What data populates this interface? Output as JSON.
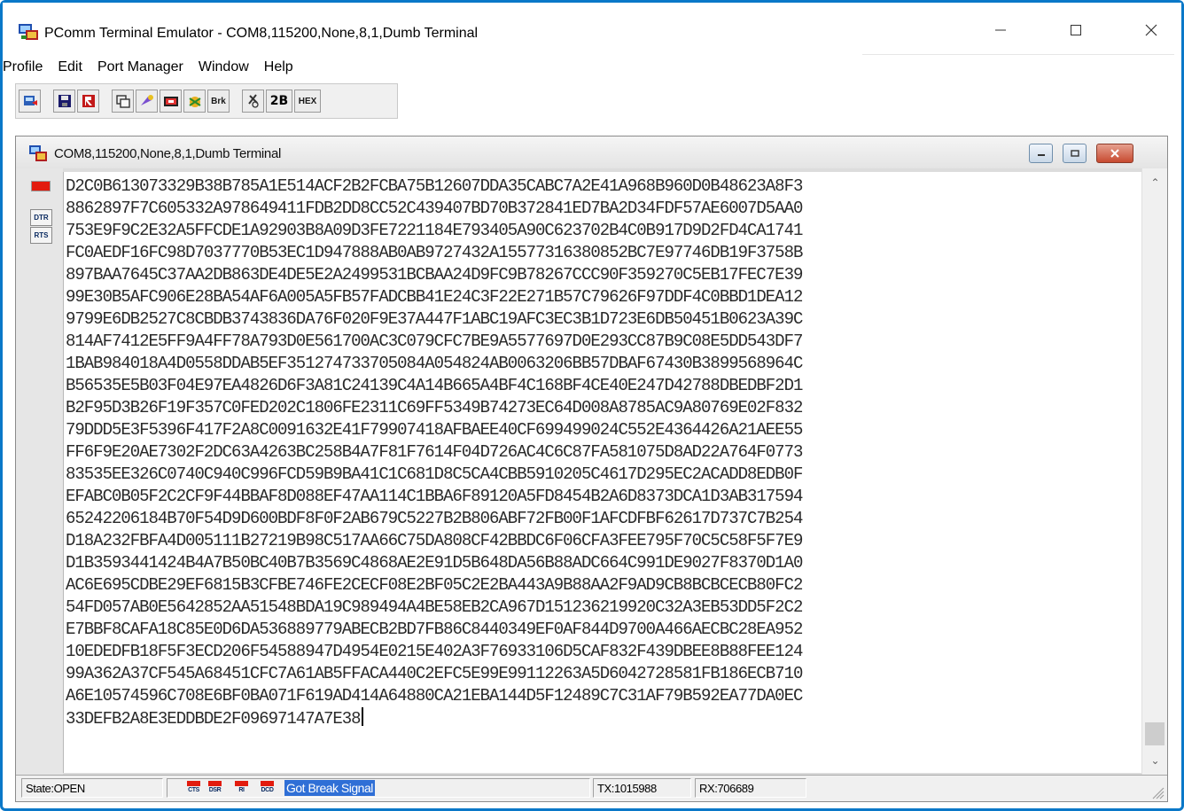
{
  "window": {
    "title": "PComm Terminal Emulator - COM8,115200,None,8,1,Dumb Terminal",
    "icon": "pcomm-app-icon"
  },
  "menu": [
    "Profile",
    "Edit",
    "Port Manager",
    "Window",
    "Help"
  ],
  "toolbar": {
    "buttons": [
      {
        "name": "open-icon"
      },
      {
        "name": "save-icon"
      },
      {
        "name": "capture-icon"
      },
      {
        "name": "settings-icon"
      },
      {
        "name": "transfer-icon"
      },
      {
        "name": "port-icon"
      },
      {
        "name": "macro-icon"
      },
      {
        "name": "break-button",
        "label": "Brk"
      },
      {
        "name": "ioctl-icon"
      },
      {
        "name": "2b-button",
        "label": "2B"
      },
      {
        "name": "hex-button",
        "label": "HEX"
      }
    ]
  },
  "child_window": {
    "title": "COM8,115200,None,8,1,Dumb Terminal"
  },
  "side_panel": {
    "dtr_label": "DTR",
    "rts_label": "RTS"
  },
  "terminal": {
    "lines": [
      "D2C0B613073329B38B785A1E514ACF2B2FCBA75B12607DDA35CABC7A2E41A968B960D0B48623A8F3",
      "8862897F7C605332A978649411FDB2DD8CC52C439407BD70B372841ED7BA2D34FDF57AE6007D5AA0",
      "753E9F9C2E32A5FFCDE1A92903B8A09D3FE7221184E793405A90C623702B4C0B917D9D2FD4CA1741",
      "FC0AEDF16FC98D7037770B53EC1D947888AB0AB9727432A15577316380852BC7E97746DB19F3758B",
      "897BAA7645C37AA2DB863DE4DE5E2A2499531BCBAA24D9FC9B78267CCC90F359270C5EB17FEC7E39",
      "99E30B5AFC906E28BA54AF6A005A5FB57FADCBB41E24C3F22E271B57C79626F97DDF4C0BBD1DEA12",
      "9799E6DB2527C8CBDB3743836DA76F020F9E37A447F1ABC19AFC3EC3B1D723E6DB50451B0623A39C",
      "814AF7412E5FF9A4FF78A793D0E561700AC3C079CFC7BE9A5577697D0E293CC87B9C08E5DD543DF7",
      "1BAB984018A4D0558DDAB5EF351274733705084A054824AB0063206BB57DBAF67430B3899568964C",
      "B56535E5B03F04E97EA4826D6F3A81C24139C4A14B665A4BF4C168BF4CE40E247D42788DBEDBF2D1",
      "B2F95D3B26F19F357C0FED202C1806FE2311C69FF5349B74273EC64D008A8785AC9A80769E02F832",
      "79DDD5E3F5396F417F2A8C0091632E41F79907418AFBAEE40CF699499024C552E4364426A21AEE55",
      "FF6F9E20AE7302F2DC63A4263BC258B4A7F81F7614F04D726AC4C6C87FA581075D8AD22A764F0773",
      "83535EE326C0740C940C996FCD59B9BA41C1C681D8C5CA4CBB5910205C4617D295EC2ACADD8EDB0F",
      "EFABC0B05F2C2CF9F44BBAF8D088EF47AA114C1BBA6F89120A5FD8454B2A6D8373DCA1D3AB317594",
      "65242206184B70F54D9D600BDF8F0F2AB679C5227B2B806ABF72FB00F1AFCDFBF62617D737C7B254",
      "D18A232FBFA4D005111B27219B98C517AA66C75DA808CF42BBDC6F06CFA3FEE795F70C5C58F5F7E9",
      "D1B3593441424B4A7B50BC40B7B3569C4868AE2E91D5B648DA56B88ADC664C991DE9027F8370D1A0",
      "AC6E695CDBE29EF6815B3CFBE746FE2CECF08E2BF05C2E2BA443A9B88AA2F9AD9CB8BCBCECB80FC2",
      "54FD057AB0E5642852AA51548BDA19C989494A4BE58EB2CA967D151236219920C32A3EB53DD5F2C2",
      "E7BBF8CAFA18C85E0D6DA536889779ABECB2BD7FB86C8440349EF0AF844D9700A466AECBC28EA952",
      "10EDEDFB18F5F3ECD206F54588947D4954E0215E402A3F76933106D5CAF832F439DBEE8B88FEE124",
      "99A362A37CF545A68451CFC7A61AB5FFACA440C2EFC5E99E99112263A5D6042728581FB186ECB710",
      "A6E10574596C708E6BF0BA071F619AD414A64880CA21EBA144D5F12489C7C31AF79B592EA77DA0EC",
      "33DEFB2A8E3EDDBDE2F09697147A7E38"
    ]
  },
  "status": {
    "state": "State:OPEN",
    "signals": [
      "CTS",
      "DSR",
      "RI",
      "DCD"
    ],
    "break_text": "Got Break Signal",
    "tx": "TX:1015988",
    "rx": "RX:706689"
  }
}
